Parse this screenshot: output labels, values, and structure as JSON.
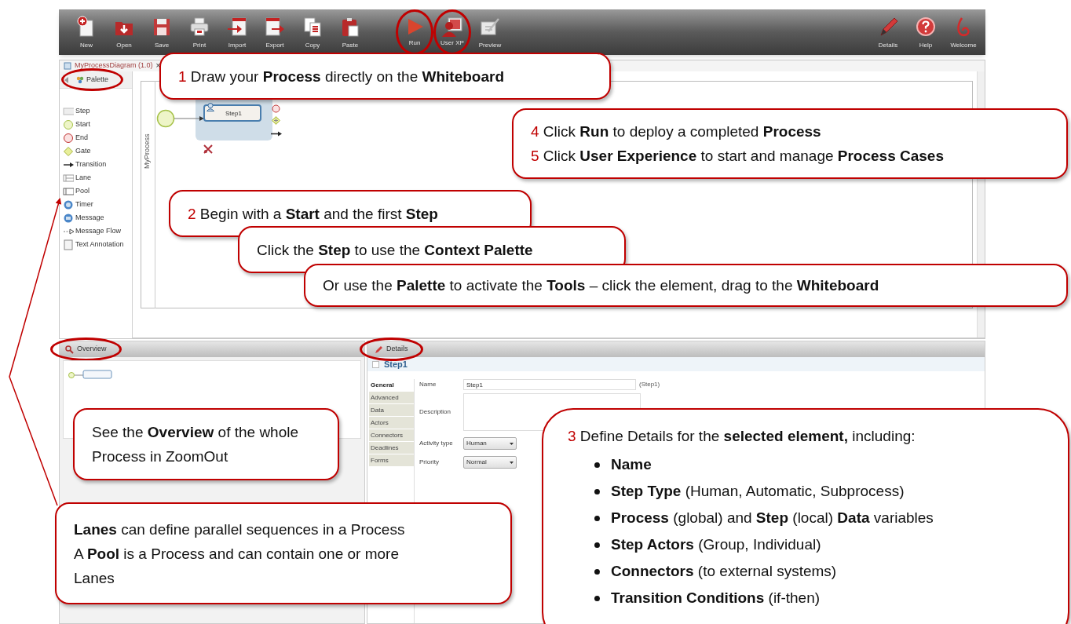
{
  "toolbar": {
    "file_tools": [
      {
        "label": "New",
        "kind": "new",
        "circled": false
      },
      {
        "label": "Open",
        "kind": "open",
        "circled": false
      },
      {
        "label": "Save",
        "kind": "save",
        "circled": false
      },
      {
        "label": "Print",
        "kind": "print",
        "circled": false
      },
      {
        "label": "Import",
        "kind": "import",
        "circled": false
      },
      {
        "label": "Export",
        "kind": "export",
        "circled": false
      },
      {
        "label": "Copy",
        "kind": "copy",
        "circled": false
      },
      {
        "label": "Paste",
        "kind": "paste",
        "circled": false
      }
    ],
    "run_tools": [
      {
        "label": "Run",
        "kind": "run",
        "circled": true
      },
      {
        "label": "User XP",
        "kind": "user",
        "circled": true
      },
      {
        "label": "Preview",
        "kind": "preview",
        "circled": false
      }
    ],
    "app_tools": [
      {
        "label": "Details",
        "kind": "details",
        "circled": false
      },
      {
        "label": "Help",
        "kind": "help",
        "circled": false
      },
      {
        "label": "Welcome",
        "kind": "welcome",
        "circled": false
      }
    ]
  },
  "editor_tab": {
    "title": "MyProcessDiagram (1.0)",
    "close": "×"
  },
  "palette": {
    "title": "Palette",
    "circled": true,
    "items": [
      {
        "label": "Step",
        "kind": "step"
      },
      {
        "label": "Start",
        "kind": "start"
      },
      {
        "label": "End",
        "kind": "end"
      },
      {
        "label": "Gate",
        "kind": "gate"
      },
      {
        "label": "Transition",
        "kind": "transition"
      },
      {
        "label": "Lane",
        "kind": "lane"
      },
      {
        "label": "Pool",
        "kind": "pool"
      },
      {
        "label": "Timer",
        "kind": "timer"
      },
      {
        "label": "Message",
        "kind": "message"
      },
      {
        "label": "Message Flow",
        "kind": "flow"
      },
      {
        "label": "Text Annotation",
        "kind": "annotation"
      }
    ]
  },
  "diagram": {
    "pool_label": "MyProcess",
    "task_label": "Step1"
  },
  "overview": {
    "title": "Overview",
    "circled": true
  },
  "details": {
    "title": "Details",
    "circled": true,
    "element_title": "Step1",
    "tabs": [
      {
        "label": "General",
        "selected": true
      },
      {
        "label": "Advanced",
        "selected": false
      },
      {
        "label": "Data",
        "selected": false
      },
      {
        "label": "Actors",
        "selected": false
      },
      {
        "label": "Connectors",
        "selected": false
      },
      {
        "label": "Deadlines",
        "selected": false
      },
      {
        "label": "Forms",
        "selected": false
      }
    ],
    "fields": [
      {
        "label": "Name",
        "kind": "text",
        "value": "Step1",
        "hint": "(Step1)"
      },
      {
        "label": "Description",
        "kind": "textarea"
      },
      {
        "label": "Activity type",
        "kind": "select",
        "value": "Human"
      },
      {
        "label": "Priority",
        "kind": "select",
        "value": "Normal"
      }
    ]
  },
  "callouts": [
    {
      "kind": "lines",
      "lines": [
        {
          "number": "1",
          "text": "Draw your **Process** directly on the **Whiteboard**"
        }
      ]
    },
    {
      "kind": "lines",
      "lines": [
        {
          "number": "4",
          "text": "Click **Run** to deploy a completed **Process**"
        },
        {
          "number": "5",
          "text": "Click **User Experience** to start and manage **Process Cases**"
        }
      ]
    },
    {
      "kind": "lines",
      "lines": [
        {
          "number": "2",
          "text": "Begin with a **Start** and the first **Step**"
        }
      ]
    },
    {
      "kind": "lines",
      "lines": [
        {
          "text": "Click the **Step** to use the **Context Palette**"
        }
      ]
    },
    {
      "kind": "lines",
      "lines": [
        {
          "text": "Or use the **Palette** to activate the **Tools** – click the element, drag to the **Whiteboard**"
        }
      ]
    },
    {
      "kind": "lines",
      "lines": [
        {
          "text": "See the **Overview** of the whole Process in ZoomOut"
        }
      ]
    },
    {
      "kind": "lines",
      "lines": [
        {
          "text": "**Lanes** can define parallel sequences in a Process"
        },
        {
          "text": "A **Pool** is a Process and can contain one or more Lanes"
        }
      ]
    },
    {
      "kind": "bullets",
      "lines": [
        {
          "number": "3",
          "text": "Define Details for the **selected element,** including:"
        }
      ],
      "bullets": [
        "**Name**",
        "**Step Type** (Human, Automatic, Subprocess)",
        "**Process** (global) and **Step** (local) **Data** variables",
        "**Step Actors** (Group, Individual)",
        "**Connectors** (to external systems)",
        "**Transition Conditions** (if-then)"
      ]
    }
  ]
}
